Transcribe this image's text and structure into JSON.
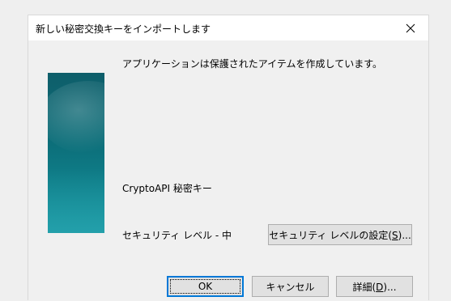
{
  "window": {
    "title": "新しい秘密交換キーをインポートします",
    "close_glyph": "✕"
  },
  "content": {
    "message": "アプリケーションは保護されたアイテムを作成しています。",
    "item_name": "CryptoAPI 秘密キー",
    "security_level": "セキュリティ レベル - 中"
  },
  "buttons": {
    "set_security_prefix": "セキュリティ レベルの設定(",
    "set_security_key": "S",
    "set_security_suffix": ")...",
    "ok": "OK",
    "cancel": "キャンセル",
    "details_prefix": "詳細(",
    "details_key": "D",
    "details_suffix": ")..."
  },
  "colors": {
    "banner_top": "#0e5e6a",
    "banner_bottom": "#17949f",
    "default_button_border": "#0078d7"
  }
}
